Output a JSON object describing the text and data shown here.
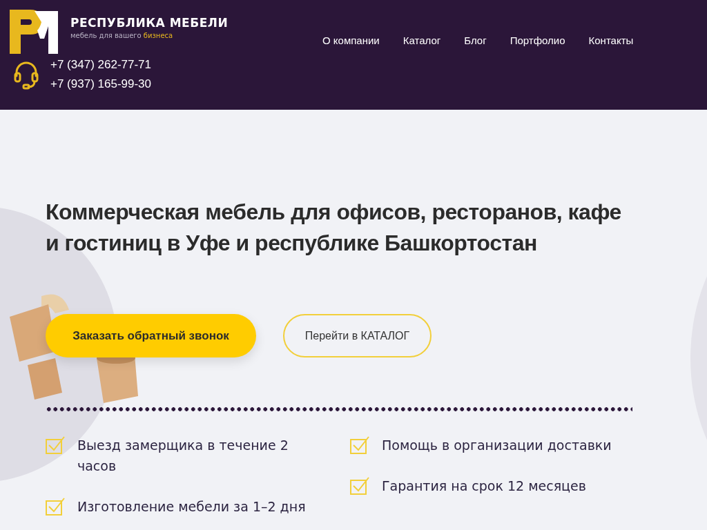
{
  "header": {
    "brand": "РЕСПУБЛИКА МЕБЕЛИ",
    "tagline": "мебель для вашего",
    "tagline_accent": "бизнеса",
    "phones": [
      "+7 (347) 262-77-71",
      "+7 (937) 165-99-30"
    ],
    "nav": [
      {
        "label": "О компании"
      },
      {
        "label": "Каталог"
      },
      {
        "label": "Блог"
      },
      {
        "label": "Портфолио"
      },
      {
        "label": "Контакты"
      }
    ]
  },
  "hero": {
    "title": "Коммерческая мебель для офисов, ресторанов, кафе и гостиниц в Уфе и республике Башкортостан",
    "buttons": [
      {
        "label": "Заказать обратный звонок",
        "kind": "primary"
      },
      {
        "label": "Перейти в КАТАЛОГ",
        "kind": "outline"
      }
    ],
    "features": [
      [
        {
          "text": "Выезд замерщика в течение 2 часов",
          "checked": true
        },
        {
          "text": "Изготовление мебели за 1–2 дня",
          "checked": true
        }
      ],
      [
        {
          "text": "Помощь в организации доставки",
          "checked": true
        },
        {
          "text": "Гарантия на срок 12 месяцев",
          "checked": true
        }
      ]
    ]
  }
}
